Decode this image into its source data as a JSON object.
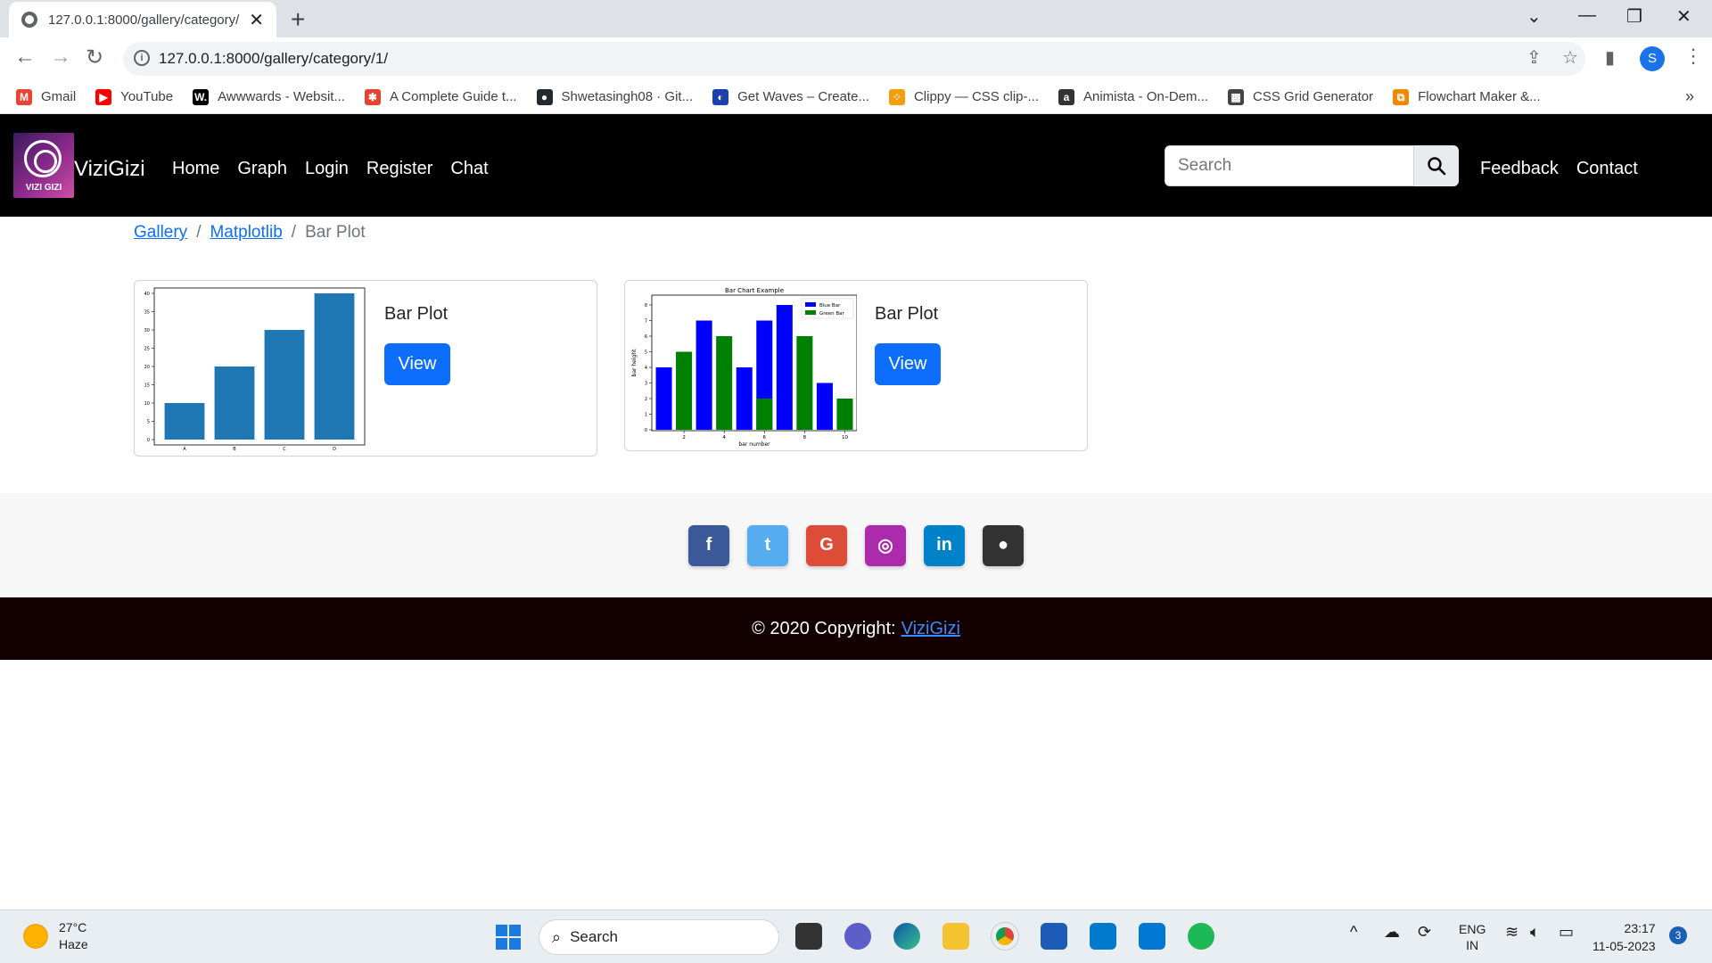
{
  "browser": {
    "tab_title": "127.0.0.1:8000/gallery/category/",
    "url": "127.0.0.1:8000/gallery/category/1/",
    "profile_initial": "S",
    "bookmarks": [
      {
        "label": "Gmail",
        "icon": "gmail-icon",
        "color": "#ea4335",
        "glyph": "M"
      },
      {
        "label": "YouTube",
        "icon": "youtube-icon",
        "color": "#ff0000",
        "glyph": "▶"
      },
      {
        "label": "Awwwards - Websit...",
        "icon": "awwwards-icon",
        "color": "#000000",
        "glyph": "W."
      },
      {
        "label": "A Complete Guide t...",
        "icon": "css-tricks-icon",
        "color": "#e8412e",
        "glyph": "✱"
      },
      {
        "label": "Shwetasingh08 · Git...",
        "icon": "github-icon",
        "color": "#24292f",
        "glyph": "●"
      },
      {
        "label": "Get Waves – Create...",
        "icon": "getwaves-icon",
        "color": "#1e40af",
        "glyph": "◐"
      },
      {
        "label": "Clippy — CSS clip-...",
        "icon": "clippy-icon",
        "color": "#f59e0b",
        "glyph": "⁘"
      },
      {
        "label": "Animista - On-Dem...",
        "icon": "animista-icon",
        "color": "#333333",
        "glyph": "a"
      },
      {
        "label": "CSS Grid Generator",
        "icon": "grid-generator-icon",
        "color": "#444444",
        "glyph": "▦"
      },
      {
        "label": "Flowchart Maker &...",
        "icon": "flowchart-icon",
        "color": "#f08705",
        "glyph": "⧉"
      }
    ]
  },
  "site": {
    "logo_text": "VIZI GIZI",
    "brand": "ViziGizi",
    "nav": [
      "Home",
      "Graph",
      "Login",
      "Register",
      "Chat"
    ],
    "search_placeholder": "Search",
    "right_nav": [
      "Feedback",
      "Contact"
    ],
    "breadcrumb": [
      "Gallery",
      "Matplotlib",
      "Bar Plot"
    ],
    "cards": [
      {
        "title": "Bar Plot",
        "button": "View"
      },
      {
        "title": "Bar Plot",
        "button": "View"
      }
    ],
    "social": [
      {
        "name": "facebook",
        "glyph": "f",
        "color": "#3b5998"
      },
      {
        "name": "twitter",
        "glyph": "t",
        "color": "#55acee"
      },
      {
        "name": "google",
        "glyph": "G",
        "color": "#dd4b39"
      },
      {
        "name": "instagram",
        "glyph": "◎",
        "color": "#ac2bac"
      },
      {
        "name": "linkedin",
        "glyph": "in",
        "color": "#0082ca"
      },
      {
        "name": "github",
        "glyph": "●",
        "color": "#333333"
      }
    ],
    "copyright_prefix": "© 2020 Copyright:",
    "copyright_link": "ViziGizi"
  },
  "chart_data": [
    {
      "type": "bar",
      "categories": [
        "A",
        "B",
        "C",
        "D"
      ],
      "values": [
        10,
        20,
        30,
        40
      ],
      "ylim": [
        0,
        40
      ],
      "yticks": [
        0,
        5,
        10,
        15,
        20,
        25,
        30,
        35,
        40
      ],
      "color": "#1f77b4"
    },
    {
      "type": "bar",
      "title": "Bar Chart Example",
      "xlabel": "bar number",
      "ylabel": "bar height",
      "xticks": [
        2,
        4,
        6,
        8,
        10
      ],
      "yticks": [
        0,
        1,
        2,
        3,
        4,
        5,
        6,
        7,
        8
      ],
      "ylim": [
        0,
        8
      ],
      "series": [
        {
          "name": "Blue Bar",
          "color": "#0000ff",
          "x": [
            1,
            3,
            5,
            6,
            7,
            9
          ],
          "values": [
            4,
            7,
            4,
            7,
            8,
            3
          ]
        },
        {
          "name": "Green Bar",
          "color": "#008000",
          "x": [
            2,
            4,
            6,
            8,
            10
          ],
          "values": [
            5,
            6,
            2,
            6,
            2
          ]
        }
      ]
    }
  ],
  "taskbar": {
    "temperature": "27°C",
    "weather": "Haze",
    "search": "Search",
    "lang1": "ENG",
    "lang2": "IN",
    "time": "23:17",
    "date": "11-05-2023",
    "notifications": "3"
  }
}
